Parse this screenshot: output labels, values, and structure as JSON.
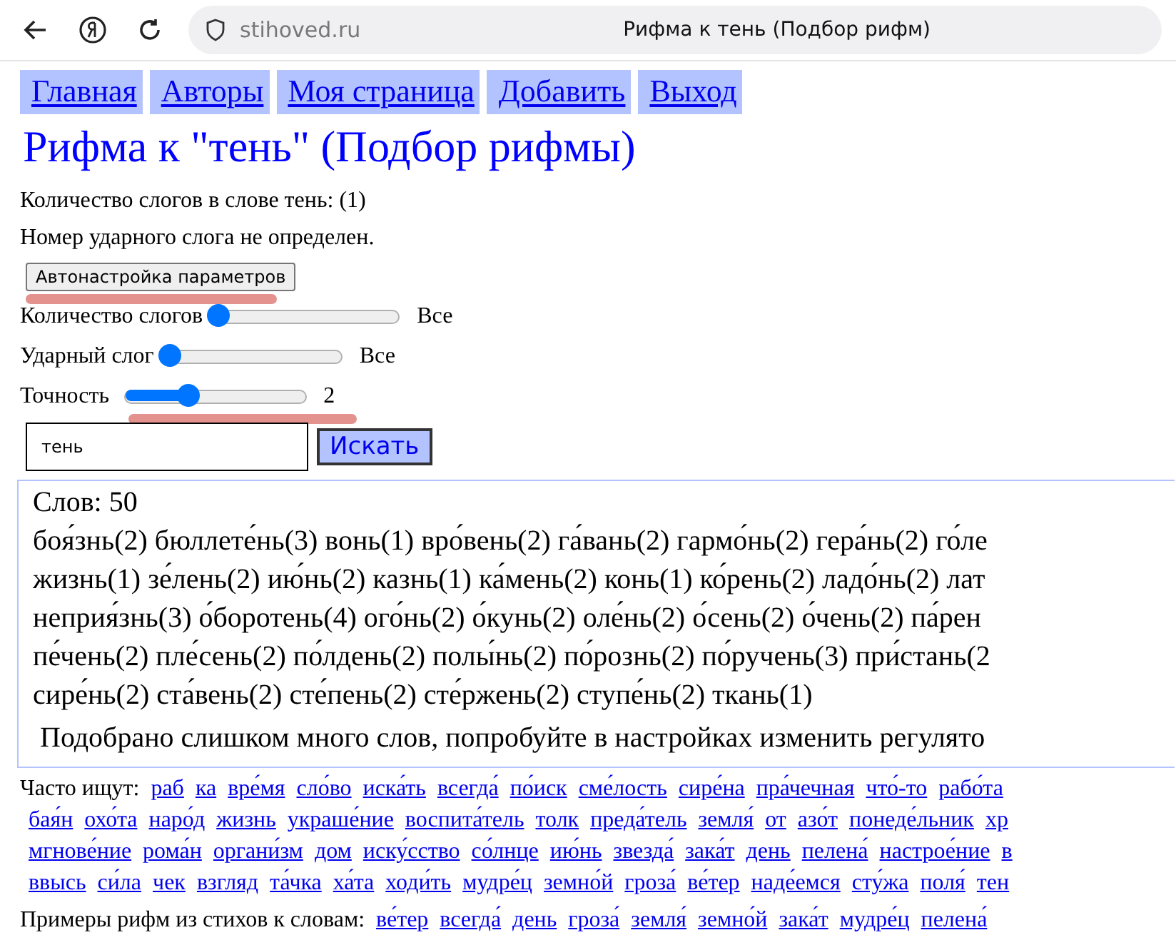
{
  "browser": {
    "address": "stihoved.ru",
    "title": "Рифма к тень (Подбор рифм)"
  },
  "nav": [
    "Главная",
    "Авторы",
    "Моя страница",
    "Добавить",
    "Выход"
  ],
  "heading": "Рифма к \"тень\" (Подбор рифмы)",
  "info": [
    "Количество слогов в слове тень: (1)",
    "Номер ударного слога не определен."
  ],
  "auto_button": {
    "label": "Автонастройка параметров",
    "underlined": true
  },
  "sliders": [
    {
      "label": "Количество слогов",
      "level": 0,
      "reading": "Все",
      "underlined": false
    },
    {
      "label": "Ударный слог",
      "level": 0,
      "reading": "Все",
      "underlined": false
    },
    {
      "label": "Точность",
      "level": 0.35,
      "reading": "2",
      "underlined": true
    }
  ],
  "search": {
    "value": "тень",
    "button": "Искать"
  },
  "results": {
    "count": "Слов: 50",
    "lines": [
      "бoя́знь(2) бюллете́нь(3) вонь(1) вро́вень(2) га́вань(2) гармо́нь(2) гера́нь(2) го́ле",
      "жизнь(1) зе́лень(2) ию́нь(2) казнь(1) ка́мень(2) конь(1) ко́рень(2) ладо́нь(2) лат",
      "неприя́знь(3) о́боротень(4) ого́нь(2) о́кунь(2) оле́нь(2) о́сень(2) о́чень(2) па́рен",
      "пе́чень(2) пле́сень(2) по́лдень(2) полы́нь(2) по́рознь(2) по́ручень(3) при́стань(2",
      "сире́нь(2) ста́вень(2) сте́пень(2) сте́ржень(2) ступе́нь(2) ткань(1)"
    ],
    "notice": "Подобрано слишком много слов, попробуйте в настройках изменить регулято"
  },
  "often": {
    "label": "Часто ищут:",
    "lines": [
      [
        "раб",
        "ка",
        "вре́мя",
        "сло́во",
        "иска́ть",
        "всегда́",
        "по́иск",
        "сме́лость",
        "сире́на",
        "пра́чечная",
        "что́-то",
        "рабо́та"
      ],
      [
        "бая́н",
        "охо́та",
        "наро́д",
        "жизнь",
        "украше́ние",
        "воспита́тель",
        "толк",
        "преда́тель",
        "земля́",
        "от",
        "азо́т",
        "понеде́льник",
        "хр"
      ],
      [
        "мгнове́ние",
        "рома́н",
        "органи́зм",
        "дом",
        "иску́сство",
        "со́лнце",
        "ию́нь",
        "звезда́",
        "зака́т",
        "день",
        "пелена́",
        "настрое́ние",
        "в"
      ],
      [
        "ввысь",
        "си́ла",
        "чек",
        "взгляд",
        "та́чка",
        "ха́та",
        "ходи́ть",
        "мудре́ц",
        "земно́й",
        "гроза́",
        "ве́тер",
        "наде́емся",
        "сту́жа",
        "поля́",
        "тен"
      ]
    ]
  },
  "examples": {
    "label": "Примеры рифм из стихов к словам:",
    "links": [
      "ве́тер",
      "всегда́",
      "день",
      "гроза́",
      "земля́",
      "земно́й",
      "зака́т",
      "мудре́ц",
      "пелена́"
    ]
  }
}
